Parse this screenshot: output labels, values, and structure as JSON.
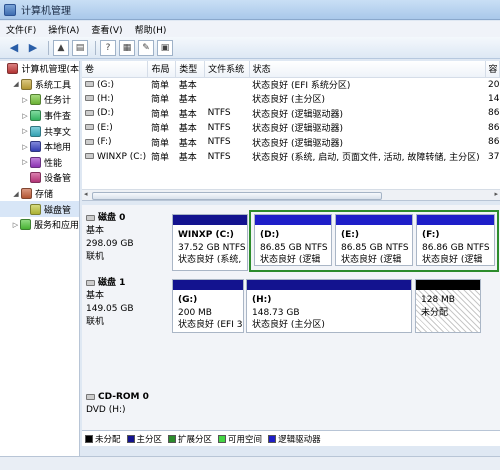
{
  "window": {
    "title": "计算机管理"
  },
  "menu": [
    "文件(F)",
    "操作(A)",
    "查看(V)",
    "帮助(H)"
  ],
  "toolbar": {
    "help": "?",
    "colors": {
      "nav": "#2a5ea8"
    }
  },
  "tree": [
    {
      "label": "计算机管理(本",
      "level": 0,
      "expander": "",
      "icon": "computer-icon"
    },
    {
      "label": "系统工具",
      "level": 1,
      "expander": "◢",
      "icon": "tools-icon"
    },
    {
      "label": "任务计",
      "level": 2,
      "expander": "▷",
      "icon": "task-scheduler-icon"
    },
    {
      "label": "事件查",
      "level": 2,
      "expander": "▷",
      "icon": "event-viewer-icon"
    },
    {
      "label": "共享文",
      "level": 2,
      "expander": "▷",
      "icon": "shared-folder-icon"
    },
    {
      "label": "本地用",
      "level": 2,
      "expander": "▷",
      "icon": "local-users-icon"
    },
    {
      "label": "性能",
      "level": 2,
      "expander": "▷",
      "icon": "performance-icon"
    },
    {
      "label": "设备管",
      "level": 2,
      "expander": "",
      "icon": "device-manager-icon"
    },
    {
      "label": "存储",
      "level": 1,
      "expander": "◢",
      "icon": "storage-icon"
    },
    {
      "label": "磁盘管",
      "level": 2,
      "expander": "",
      "icon": "disk-management-icon",
      "selected": true
    },
    {
      "label": "服务和应用",
      "level": 1,
      "expander": "▷",
      "icon": "services-icon"
    }
  ],
  "volume_table": {
    "headers": [
      "卷",
      "布局",
      "类型",
      "文件系统",
      "状态",
      "容"
    ],
    "rows": [
      [
        "(G:)",
        "简单",
        "基本",
        "",
        "状态良好 (EFI 系统分区)",
        "20"
      ],
      [
        "(H:)",
        "简单",
        "基本",
        "",
        "状态良好 (主分区)",
        "14"
      ],
      [
        "(D:)",
        "简单",
        "基本",
        "NTFS",
        "状态良好 (逻辑驱动器)",
        "86"
      ],
      [
        "(E:)",
        "简单",
        "基本",
        "NTFS",
        "状态良好 (逻辑驱动器)",
        "86"
      ],
      [
        "(F:)",
        "简单",
        "基本",
        "NTFS",
        "状态良好 (逻辑驱动器)",
        "86"
      ],
      [
        "WINXP (C:)",
        "简单",
        "基本",
        "NTFS",
        "状态良好 (系统, 启动, 页面文件, 活动, 故障转储, 主分区)",
        "37"
      ]
    ],
    "scroll_left": "◂",
    "scroll_right": "▸"
  },
  "disks": [
    {
      "name": "磁盘 0",
      "type": "基本",
      "size": "298.09 GB",
      "status": "联机",
      "partitions": [
        {
          "label": "WINXP  (C:)",
          "size": "37.52 GB NTFS",
          "status": "状态良好 (系统,",
          "kind": "primary"
        },
        {
          "label": "(D:)",
          "size": "86.85 GB NTFS",
          "status": "状态良好 (逻辑",
          "kind": "logical"
        },
        {
          "label": "(E:)",
          "size": "86.85 GB NTFS",
          "status": "状态良好 (逻辑",
          "kind": "logical"
        },
        {
          "label": "(F:)",
          "size": "86.86 GB NTFS",
          "status": "状态良好 (逻辑",
          "kind": "logical"
        }
      ]
    },
    {
      "name": "磁盘 1",
      "type": "基本",
      "size": "149.05 GB",
      "status": "联机",
      "partitions": [
        {
          "label": "(G:)",
          "size": "200 MB",
          "status": "状态良好 (EFI 3",
          "kind": "primary"
        },
        {
          "label": "(H:)",
          "size": "148.73 GB",
          "status": "状态良好 (主分区)",
          "kind": "primary"
        },
        {
          "label": "",
          "size": "128 MB",
          "status": "未分配",
          "kind": "unallocated"
        }
      ]
    },
    {
      "name": "CD-ROM 0",
      "type": "DVD (H:)",
      "size": "",
      "status": "",
      "partitions": []
    }
  ],
  "legend": [
    {
      "label": "未分配",
      "color": "#000000"
    },
    {
      "label": "主分区",
      "color": "#13138f"
    },
    {
      "label": "扩展分区",
      "color": "#2c8c2c"
    },
    {
      "label": "可用空间",
      "color": "#44d644"
    },
    {
      "label": "逻辑驱动器",
      "color": "#1e1ec8"
    }
  ]
}
